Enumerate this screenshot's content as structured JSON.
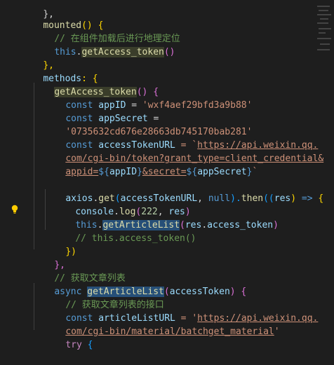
{
  "code": {
    "l0": "},",
    "l1a": "mounted",
    "l1b": "() {",
    "l2": "// 在组件加载后进行地理定位",
    "l3a": "this",
    "l3b": ".",
    "l3c": "getAccess_token",
    "l3d": "()",
    "l4": "},",
    "l5a": "methods",
    "l5b": ": {",
    "l6a": "getAccess_token",
    "l6b": "() {",
    "l7a": "const",
    "l7b": "appID",
    "l7c": " = ",
    "l7d": "'wxf4aef29bfd3a9b88'",
    "l8a": "const",
    "l8b": "appSecret",
    "l8c": " =",
    "l9": "'0735632cd676e28663db745170bab281'",
    "l10a": "const",
    "l10b": "accessTokenURL",
    "l10c": " = `",
    "l10d": "https://api.weixin.qq.",
    "l11": "com/cgi-bin/token?grant_type=client_credential&",
    "l12a": "appid=",
    "l12b": "${",
    "l12c": "appID",
    "l12d": "}",
    "l12e": "&secret=",
    "l12f": "${",
    "l12g": "appSecret",
    "l12h": "}",
    "l12i": "`",
    "l14a": "axios",
    "l14b": ".",
    "l14c": "get",
    "l14d": "(",
    "l14e": "accessTokenURL",
    "l14f": ", ",
    "l14g": "null",
    "l14h": ").",
    "l14i": "then",
    "l14j": "((",
    "l14k": "res",
    "l14l": ") ",
    "l14m": "=>",
    "l14n": " {",
    "l15a": "console",
    "l15b": ".",
    "l15c": "log",
    "l15d": "(",
    "l15e": "222",
    "l15f": ", ",
    "l15g": "res",
    "l15h": ")",
    "l16a": "this",
    "l16b": ".",
    "l16c": "getArticleList",
    "l16d": "(",
    "l16e": "res",
    "l16f": ".",
    "l16g": "access_token",
    "l16h": ")",
    "l17": "// this.access_token()",
    "l18": "})",
    "l19": "},",
    "l20": "// 获取文章列表",
    "l21a": "async",
    "l21b": "getArticleList",
    "l21c": "(",
    "l21d": "accessToken",
    "l21e": ") {",
    "l22": "// 获取文章列表的接口",
    "l23a": "const",
    "l23b": "articleListURL",
    "l23c": " = '",
    "l23d": "https://api.weixin.qq.",
    "l24a": "com/cgi-bin/material/batchget_material",
    "l24b": "'",
    "l25a": "try",
    "l25b": " {"
  },
  "colors": {
    "background": "#1e1e1e",
    "keyword": "#569cd6",
    "control": "#c586c0",
    "function": "#dcdcaa",
    "variable": "#9cdcfe",
    "string": "#ce9178",
    "comment": "#6a9955",
    "number": "#b5cea8"
  },
  "icons": {
    "lightbulb": "lightbulb-icon"
  }
}
